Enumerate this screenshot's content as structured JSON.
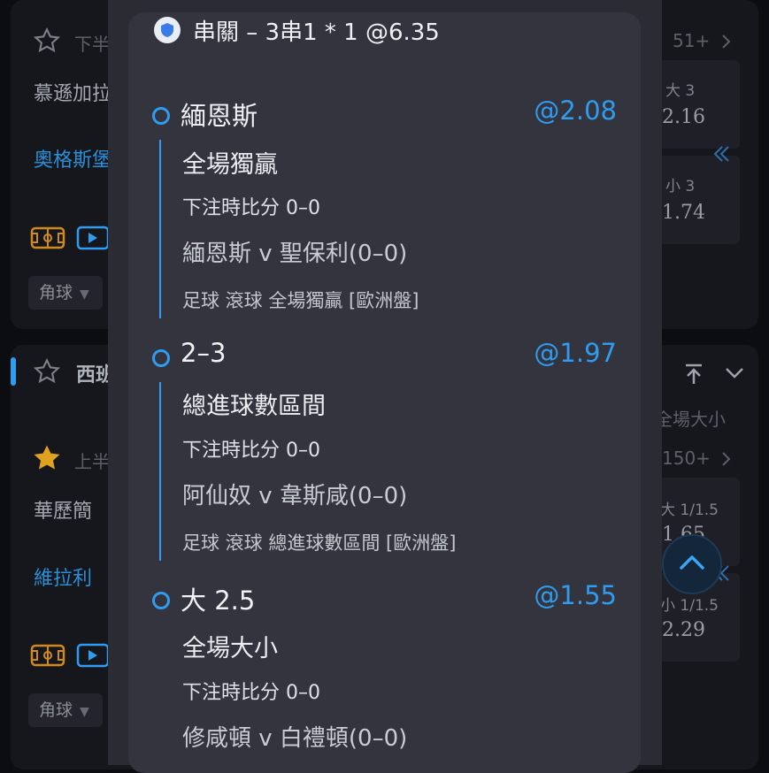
{
  "background": {
    "card1": {
      "title_partial": "下半",
      "more_count": "51+",
      "team_a": "慕遜加拉",
      "team_b": "奧格斯堡",
      "odds": [
        {
          "label": "大 3",
          "value": "2.16"
        },
        {
          "label": "小 3",
          "value": "1.74"
        }
      ],
      "select": "角球"
    },
    "card2": {
      "league_partial": "西班",
      "half_partial": "上半",
      "market_right": "全場大小",
      "more_count": "150+",
      "team_a": "華歷簡",
      "team_b": "維拉利",
      "odds": [
        {
          "label": "大 1/1.5",
          "value": "1.65"
        },
        {
          "label": "小 1/1.5",
          "value": "2.29"
        }
      ],
      "select": "角球"
    }
  },
  "modal": {
    "header": "串關 – 3串1 * 1 @6.35",
    "legs": [
      {
        "selection": "緬恩斯",
        "odds": "@2.08",
        "market": "全場獨贏",
        "score": "下注時比分 0–0",
        "match": "緬恩斯 v 聖保利(0–0)",
        "info": "足球  滾球    全場獨贏 [歐洲盤]"
      },
      {
        "selection": "2–3",
        "odds": "@1.97",
        "market": "總進球數區間",
        "score": "下注時比分 0–0",
        "match": "阿仙奴 v 韋斯咸(0–0)",
        "info": "足球  滾球    總進球數區間 [歐洲盤]"
      },
      {
        "selection": "大 2.5",
        "odds": "@1.55",
        "market": "全場大小",
        "score": "下注時比分 0–0",
        "match": "修咸頓 v 白禮頓(0–0)",
        "info": ""
      }
    ]
  },
  "colors": {
    "accent": "#2f9cf0",
    "modal_bg": "#33343d",
    "page_bg": "#0c0d11"
  },
  "icons": [
    "star-outline-icon",
    "star-filled-icon",
    "stadium-icon",
    "video-icon",
    "chevron-right-icon",
    "chevron-down-icon",
    "pin-top-icon",
    "double-chevron-left-icon",
    "chevron-up-icon"
  ]
}
